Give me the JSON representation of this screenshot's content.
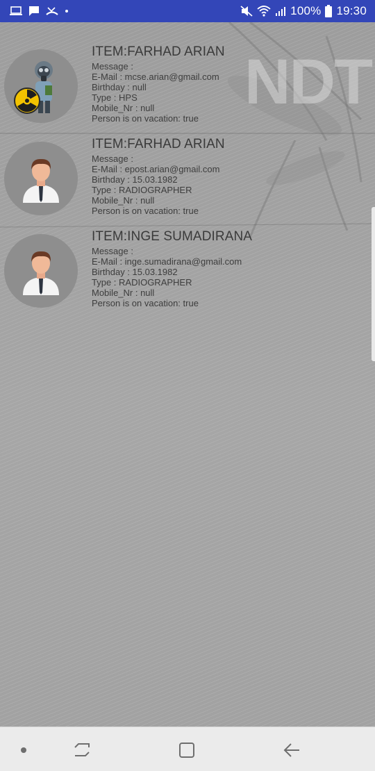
{
  "status_bar": {
    "left_icons": [
      "laptop-icon",
      "chat-icon",
      "missed-call-icon",
      "dot-icon"
    ],
    "right_icons": [
      "mute-vibrate-icon",
      "wifi-icon",
      "signal-icon",
      "battery-icon"
    ],
    "battery": "100%",
    "time": "19:30",
    "color": "#3346b8"
  },
  "background": {
    "logo_text": "NDT"
  },
  "contacts": [
    {
      "avatar": "gas-mask-radiation-icon",
      "title": "ITEM:FARHAD ARIAN",
      "message": "Message :",
      "email": "E-Mail : mcse.arian@gmail.com",
      "birthday": "Birthday : null",
      "type": "Type : HPS",
      "mobile": "Mobile_Nr : null",
      "vacation": "Person is on vacation: true"
    },
    {
      "avatar": "person-icon",
      "title": "ITEM:FARHAD ARIAN",
      "message": "Message :",
      "email": "E-Mail : epost.arian@gmail.com",
      "birthday": "Birthday : 15.03.1982",
      "type": "Type : RADIOGRAPHER",
      "mobile": "Mobile_Nr : null",
      "vacation": "Person is on vacation: true"
    },
    {
      "avatar": "person-icon",
      "title": "ITEM:INGE SUMADIRANA",
      "message": "Message :",
      "email": "E-Mail : inge.sumadirana@gmail.com",
      "birthday": "Birthday : 15.03.1982",
      "type": "Type : RADIOGRAPHER",
      "mobile": "Mobile_Nr : null",
      "vacation": "Person is on vacation: true"
    }
  ],
  "nav_bar": {
    "buttons": [
      "dot-icon",
      "recent-apps-icon",
      "home-icon",
      "back-icon"
    ]
  }
}
